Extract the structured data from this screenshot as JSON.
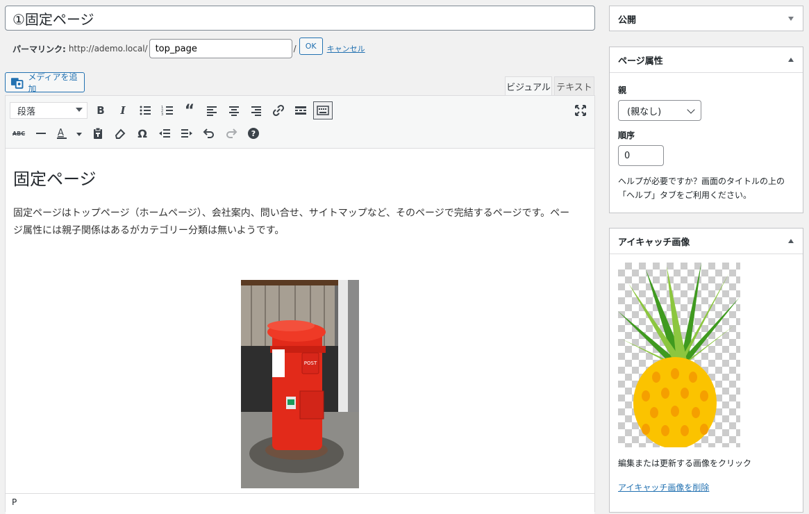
{
  "title": {
    "value": "①固定ページ"
  },
  "permalink": {
    "label": "パーマリンク:",
    "base": "http://ademo.local/",
    "slug": "top_page",
    "trailing": "/",
    "ok": "OK",
    "cancel": "キャンセル"
  },
  "editor": {
    "media_button": "メディアを追加",
    "tabs": {
      "visual": "ビジュアル",
      "text": "テキスト"
    },
    "format_select": "段落",
    "heading": "固定ページ",
    "paragraph": "固定ページはトップページ（ホームページ）、会社案内、問い合せ、サイトマップなど、そのページで完結するページです。ページ属性には親子関係はあるがカテゴリー分類は無いようです。",
    "status_path": "P"
  },
  "sidebar": {
    "publish": {
      "title": "公開"
    },
    "page_attributes": {
      "title": "ページ属性",
      "parent_label": "親",
      "parent_value": "(親なし)",
      "order_label": "順序",
      "order_value": "0",
      "help": "ヘルプが必要ですか？画面のタイトルの上の「ヘルプ」タブをご利用ください。"
    },
    "featured_image": {
      "title": "アイキャッチ画像",
      "hint": "編集または更新する画像をクリック",
      "remove": "アイキャッチ画像を削除"
    }
  },
  "colors": {
    "accent": "#2271b1",
    "background": "#f1f1f1"
  }
}
